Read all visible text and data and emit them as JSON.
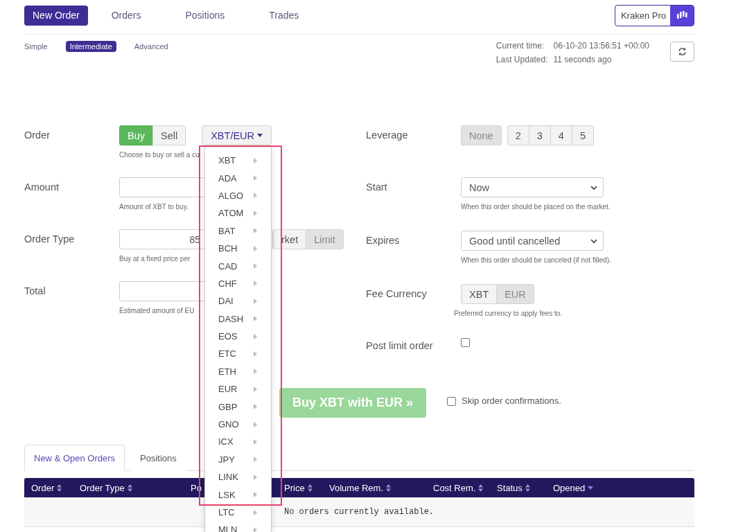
{
  "nav": {
    "tabs": [
      {
        "label": "New Order",
        "selected": true
      },
      {
        "label": "Orders",
        "selected": false
      },
      {
        "label": "Positions",
        "selected": false
      },
      {
        "label": "Trades",
        "selected": false
      }
    ],
    "pro_button": "Kraken Pro"
  },
  "modes": [
    {
      "label": "Simple",
      "selected": false
    },
    {
      "label": "Intermediate",
      "selected": true
    },
    {
      "label": "Advanced",
      "selected": false
    }
  ],
  "status": {
    "current_time_label": "Current time:",
    "current_time": "06-10-20 13:56:51 +00:00",
    "updated_label": "Last Updated:",
    "updated": "11 seconds ago"
  },
  "left_form": [
    {
      "kind": "side",
      "label": "Order",
      "options": [
        {
          "label": "Buy",
          "selected": true
        },
        {
          "label": "Sell",
          "selected": false
        }
      ],
      "pair": "XBT/EUR",
      "hint": "Choose to buy or sell a cu"
    },
    {
      "kind": "input",
      "label": "Amount",
      "hint": "Amount of XBT to buy."
    },
    {
      "kind": "price",
      "label": "Order Type",
      "value": "85",
      "options": [
        {
          "label": "rket",
          "selected": false
        },
        {
          "label": "Limit",
          "selected": true
        }
      ],
      "hint": "Buy at a fixed price per"
    },
    {
      "kind": "input",
      "label": "Total",
      "hint": "Estimated amount of EU"
    }
  ],
  "right_form": [
    {
      "kind": "leverage",
      "label": "Leverage",
      "options": [
        {
          "label": "None",
          "selected": true
        },
        {
          "label": "2",
          "selected": false
        },
        {
          "label": "3",
          "selected": false
        },
        {
          "label": "4",
          "selected": false
        },
        {
          "label": "5",
          "selected": false
        }
      ]
    },
    {
      "kind": "select",
      "label": "Start",
      "value": "Now",
      "hint": "When this order should be placed on the market."
    },
    {
      "kind": "select",
      "label": "Expires",
      "value": "Good until cancelled",
      "hint": "When this order should be canceled (if not filled)."
    },
    {
      "kind": "toggle",
      "label": "Fee Currency",
      "options": [
        {
          "label": "XBT",
          "selected": false
        },
        {
          "label": "EUR",
          "selected": true
        }
      ],
      "hint": "Preferred currency to apply fees to."
    },
    {
      "kind": "checkbox",
      "label": "Post limit order",
      "checked": false
    }
  ],
  "submit": {
    "label": "Buy XBT with EUR »",
    "disabled": true
  },
  "skip_confirm": {
    "label": "Skip order confirmations.",
    "checked": false
  },
  "bottom_tabs": [
    {
      "label": "New & Open Orders",
      "selected": true
    },
    {
      "label": "Positions",
      "selected": false
    }
  ],
  "table": {
    "columns": [
      {
        "label": "Order",
        "sorted": false
      },
      {
        "label": "Order Type",
        "sorted": false
      },
      {
        "label": "Po"
      },
      {
        "label": "Price",
        "sorted": false
      },
      {
        "label": "Volume Rem.",
        "sorted": false
      },
      {
        "label": "Cost Rem.",
        "sorted": false
      },
      {
        "label": "Status",
        "sorted": false
      },
      {
        "label": "Opened",
        "sorted": true
      }
    ],
    "empty": "No orders currently available."
  },
  "pair_menu": {
    "items": [
      "XBT",
      "ADA",
      "ALGO",
      "ATOM",
      "BAT",
      "BCH",
      "CAD",
      "CHF",
      "DAI",
      "DASH",
      "EOS",
      "ETC",
      "ETH",
      "EUR",
      "GBP",
      "GNO",
      "ICX",
      "JPY",
      "LINK",
      "LSK",
      "LTC",
      "MLN"
    ]
  }
}
